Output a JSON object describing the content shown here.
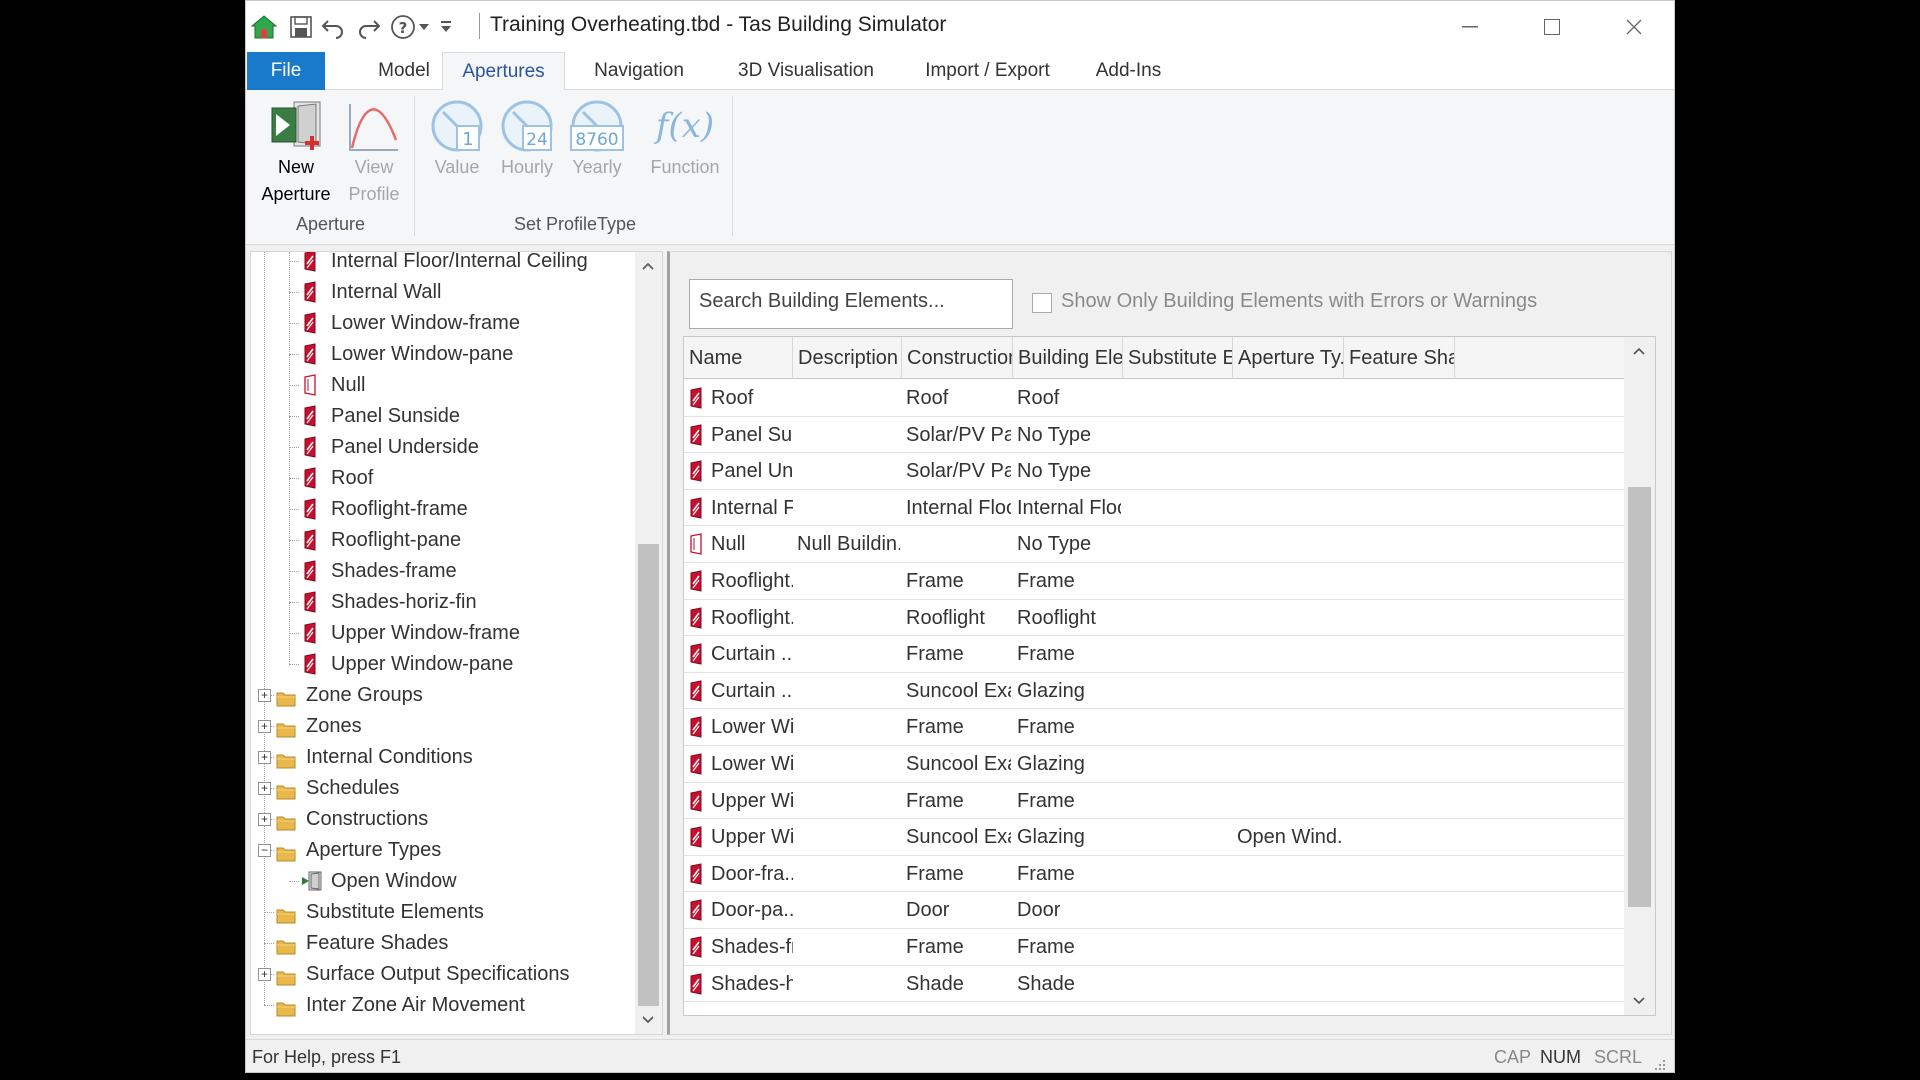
{
  "window": {
    "title": "Training Overheating.tbd - Tas Building Simulator"
  },
  "menu": {
    "file": "File",
    "tabs": [
      "Model",
      "Apertures",
      "Navigation",
      "3D Visualisation",
      "Import / Export",
      "Add-Ins"
    ],
    "active_tab": "Apertures"
  },
  "ribbon": {
    "new_aperture": [
      "New",
      "Aperture"
    ],
    "view_profile": [
      "View",
      "Profile"
    ],
    "value": "Value",
    "value_num": "1",
    "hourly": "Hourly",
    "hourly_num": "24",
    "yearly": "Yearly",
    "yearly_num": "8760",
    "function": "Function",
    "function_glyph": "f(x)",
    "group_aperture": "Aperture",
    "group_profiletype": "Set ProfileType"
  },
  "tree": {
    "children": [
      {
        "label": "Internal Floor/Internal Ceiling",
        "icon": "building-element-icon"
      },
      {
        "label": "Internal Wall",
        "icon": "building-element-icon"
      },
      {
        "label": "Lower Window-frame",
        "icon": "building-element-icon"
      },
      {
        "label": "Lower Window-pane",
        "icon": "building-element-icon"
      },
      {
        "label": "Null",
        "icon": "null-element-icon"
      },
      {
        "label": "Panel Sunside",
        "icon": "building-element-icon"
      },
      {
        "label": "Panel Underside",
        "icon": "building-element-icon"
      },
      {
        "label": "Roof",
        "icon": "building-element-icon"
      },
      {
        "label": "Rooflight-frame",
        "icon": "building-element-icon"
      },
      {
        "label": "Rooflight-pane",
        "icon": "building-element-icon"
      },
      {
        "label": "Shades-frame",
        "icon": "building-element-icon"
      },
      {
        "label": "Shades-horiz-fin",
        "icon": "building-element-icon"
      },
      {
        "label": "Upper Window-frame",
        "icon": "building-element-icon"
      },
      {
        "label": "Upper Window-pane",
        "icon": "building-element-icon"
      }
    ],
    "folders": [
      {
        "label": "Zone Groups",
        "expander": "+"
      },
      {
        "label": "Zones",
        "expander": "+"
      },
      {
        "label": "Internal Conditions",
        "expander": "+"
      },
      {
        "label": "Schedules",
        "expander": "+"
      },
      {
        "label": "Constructions",
        "expander": "+"
      },
      {
        "label": "Aperture Types",
        "expander": "−"
      },
      {
        "label": "Open Window",
        "expander": "",
        "child": true
      },
      {
        "label": "Substitute Elements",
        "expander": ""
      },
      {
        "label": "Feature Shades",
        "expander": ""
      },
      {
        "label": "Surface Output Specifications",
        "expander": "+"
      },
      {
        "label": "Inter Zone Air Movement",
        "expander": ""
      }
    ]
  },
  "search": {
    "placeholder": "Search Building Elements...",
    "filter_label": "Show Only Building Elements with Errors or Warnings"
  },
  "grid": {
    "columns": [
      "Name",
      "Description",
      "Construction",
      "Building Ele...",
      "Substitute E...",
      "Aperture Ty...",
      "Feature Sha..."
    ],
    "rows": [
      {
        "name": "Roof",
        "description": "",
        "construction": "Roof",
        "building_element": "Roof",
        "substitute": "",
        "aperture_type": "",
        "feature_shade": "",
        "icon": "building-element-icon"
      },
      {
        "name": "Panel Sun...",
        "description": "",
        "construction": "Solar/PV Pa...",
        "building_element": "No Type",
        "substitute": "",
        "aperture_type": "",
        "feature_shade": "",
        "icon": "building-element-icon"
      },
      {
        "name": "Panel Un...",
        "description": "",
        "construction": "Solar/PV Pa...",
        "building_element": "No Type",
        "substitute": "",
        "aperture_type": "",
        "feature_shade": "",
        "icon": "building-element-icon"
      },
      {
        "name": "Internal F...",
        "description": "",
        "construction": "Internal Floor",
        "building_element": "Internal Floor",
        "substitute": "",
        "aperture_type": "",
        "feature_shade": "",
        "icon": "building-element-icon"
      },
      {
        "name": "Null",
        "description": "Null Buildin...",
        "construction": "",
        "building_element": "No Type",
        "substitute": "",
        "aperture_type": "",
        "feature_shade": "",
        "icon": "null-element-icon"
      },
      {
        "name": "Rooflight...",
        "description": "",
        "construction": "Frame",
        "building_element": "Frame",
        "substitute": "",
        "aperture_type": "",
        "feature_shade": "",
        "icon": "building-element-icon"
      },
      {
        "name": "Rooflight...",
        "description": "",
        "construction": "Rooflight",
        "building_element": "Rooflight",
        "substitute": "",
        "aperture_type": "",
        "feature_shade": "",
        "icon": "building-element-icon"
      },
      {
        "name": "Curtain ...",
        "description": "",
        "construction": "Frame",
        "building_element": "Frame",
        "substitute": "",
        "aperture_type": "",
        "feature_shade": "",
        "icon": "building-element-icon"
      },
      {
        "name": "Curtain ...",
        "description": "",
        "construction": "Suncool Exa...",
        "building_element": "Glazing",
        "substitute": "",
        "aperture_type": "",
        "feature_shade": "",
        "icon": "building-element-icon"
      },
      {
        "name": "Lower Wi...",
        "description": "",
        "construction": "Frame",
        "building_element": "Frame",
        "substitute": "",
        "aperture_type": "",
        "feature_shade": "",
        "icon": "building-element-icon"
      },
      {
        "name": "Lower Wi...",
        "description": "",
        "construction": "Suncool Exa...",
        "building_element": "Glazing",
        "substitute": "",
        "aperture_type": "",
        "feature_shade": "",
        "icon": "building-element-icon"
      },
      {
        "name": "Upper Wi...",
        "description": "",
        "construction": "Frame",
        "building_element": "Frame",
        "substitute": "",
        "aperture_type": "",
        "feature_shade": "",
        "icon": "building-element-icon"
      },
      {
        "name": "Upper Wi...",
        "description": "",
        "construction": "Suncool Exa...",
        "building_element": "Glazing",
        "substitute": "",
        "aperture_type": "Open Wind...",
        "feature_shade": "",
        "icon": "building-element-icon"
      },
      {
        "name": "Door-fra...",
        "description": "",
        "construction": "Frame",
        "building_element": "Frame",
        "substitute": "",
        "aperture_type": "",
        "feature_shade": "",
        "icon": "building-element-icon"
      },
      {
        "name": "Door-pa...",
        "description": "",
        "construction": "Door",
        "building_element": "Door",
        "substitute": "",
        "aperture_type": "",
        "feature_shade": "",
        "icon": "building-element-icon"
      },
      {
        "name": "Shades-fr...",
        "description": "",
        "construction": "Frame",
        "building_element": "Frame",
        "substitute": "",
        "aperture_type": "",
        "feature_shade": "",
        "icon": "building-element-icon"
      },
      {
        "name": "Shades-h...",
        "description": "",
        "construction": "Shade",
        "building_element": "Shade",
        "substitute": "",
        "aperture_type": "",
        "feature_shade": "",
        "icon": "building-element-icon"
      }
    ]
  },
  "status": {
    "help": "For Help, press F1",
    "cap": "CAP",
    "num": "NUM",
    "scrl": "SCRL"
  },
  "colors": {
    "accent": "#1979ca",
    "element_red": "#c8102e",
    "folder_yellow": "#e8b84a",
    "disabled_blue": "#9cc3e6"
  }
}
